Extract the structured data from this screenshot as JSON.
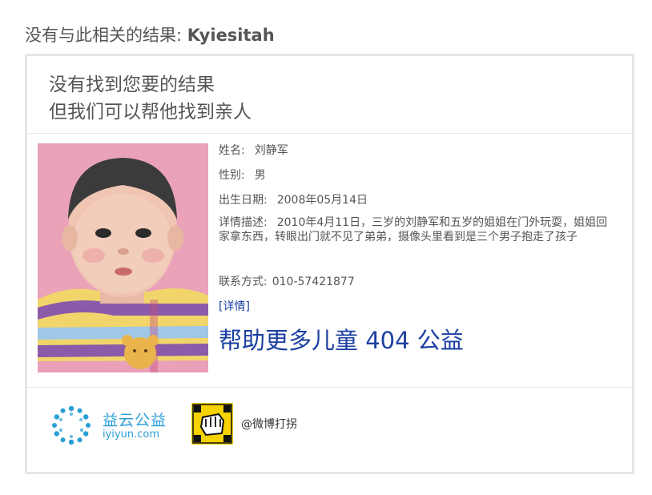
{
  "header": {
    "prefix": "没有与此相关的结果: ",
    "query": "Kyiesitah"
  },
  "card": {
    "title_line1": "没有找到您要的结果",
    "title_line2": "但我们可以帮他找到亲人"
  },
  "child": {
    "name_label": "姓名:",
    "name": "刘静军",
    "gender_label": "性别:",
    "gender": "男",
    "birth_label": "出生日期:",
    "birth": "2008年05月14日",
    "desc_label": "详情描述:",
    "desc": "2010年4月11日，三岁的刘静军和五岁的姐姐在门外玩耍，姐姐回家拿东西，转眼出门就不见了弟弟，摄像头里看到是三个男子抱走了孩子",
    "contact_label": "联系方式:",
    "contact": "010-57421877",
    "detail_link": "[详情]"
  },
  "promo_link": "帮助更多儿童 404 公益",
  "footer": {
    "yiyun_title": "益云公益",
    "yiyun_domain": "iyiyun.com",
    "weibo_logo_text": "微博打拐",
    "weibo_link": "@微博打拐"
  },
  "colors": {
    "link": "#1a3fa0",
    "yiyun_brand": "#2a9fd6",
    "weibo_yellow": "#f5d200",
    "photo_bg": "#e79ab3"
  }
}
